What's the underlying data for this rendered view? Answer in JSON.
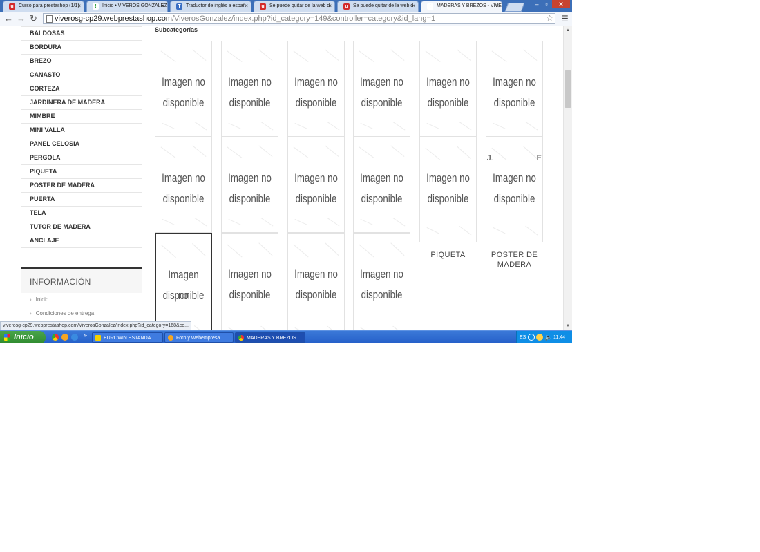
{
  "browser": {
    "tabs": [
      {
        "label": "Curso para prestashop (1/1)",
        "icon": "u-logo-icon"
      },
      {
        "label": "Inicio • VIVEROS GONZALEZ",
        "icon": "exclamation-icon"
      },
      {
        "label": "Traductor de inglés a españ",
        "icon": "translator-icon"
      },
      {
        "label": "Se puede quitar de la web d",
        "icon": "u-logo-icon"
      },
      {
        "label": "Se puede quitar de la web d",
        "icon": "u-logo-icon"
      },
      {
        "label": "MADERAS Y BREZOS - VIVE",
        "icon": "exclamation-icon"
      }
    ],
    "tab_close_glyph": "×",
    "url_host": "viverosg-cp29.webprestashop.com",
    "url_path": "/ViverosGonzalez/index.php?id_category=149&controller=category&id_lang=1",
    "window_controls": [
      "–",
      "▫",
      "✕"
    ],
    "status_url": "viverosg-cp29.webprestashop.com/ViverosGonzalez/index.php?id_category=168&co..."
  },
  "sidebar": {
    "categories": [
      "BALDOSAS",
      "BORDURA",
      "BREZO",
      "CANASTO",
      "CORTEZA",
      "JARDINERA DE MADERA",
      "MIMBRE",
      "MINI VALLA",
      "PANEL CELOSIA",
      "PERGOLA",
      "PIQUETA",
      "POSTER DE MADERA",
      "PUERTA",
      "TELA",
      "TUTOR DE MADERA",
      "ANCLAJE"
    ],
    "info_title": "INFORMACIÓN",
    "info_links": [
      "Inicio",
      "Condiciones de entrega"
    ],
    "chevron": "›"
  },
  "main": {
    "subcat_heading": "Subcategorías",
    "placeholder_line1": "Imagen no",
    "placeholder_line2": "disponible",
    "hint_left": "J.",
    "hint_right": "E",
    "labels": [
      "PIQUETA",
      "POSTER DE MADERA"
    ]
  },
  "taskbar": {
    "start_label": "Inicio",
    "tasks": [
      {
        "label": "EUROWIN ESTANDA..."
      },
      {
        "label": "Foro y  Webempresa ..."
      },
      {
        "label": "MADERAS Y BREZOS ..."
      }
    ],
    "quick_launch_more": "»",
    "tray_lang": "ES",
    "clock": "11:44"
  }
}
